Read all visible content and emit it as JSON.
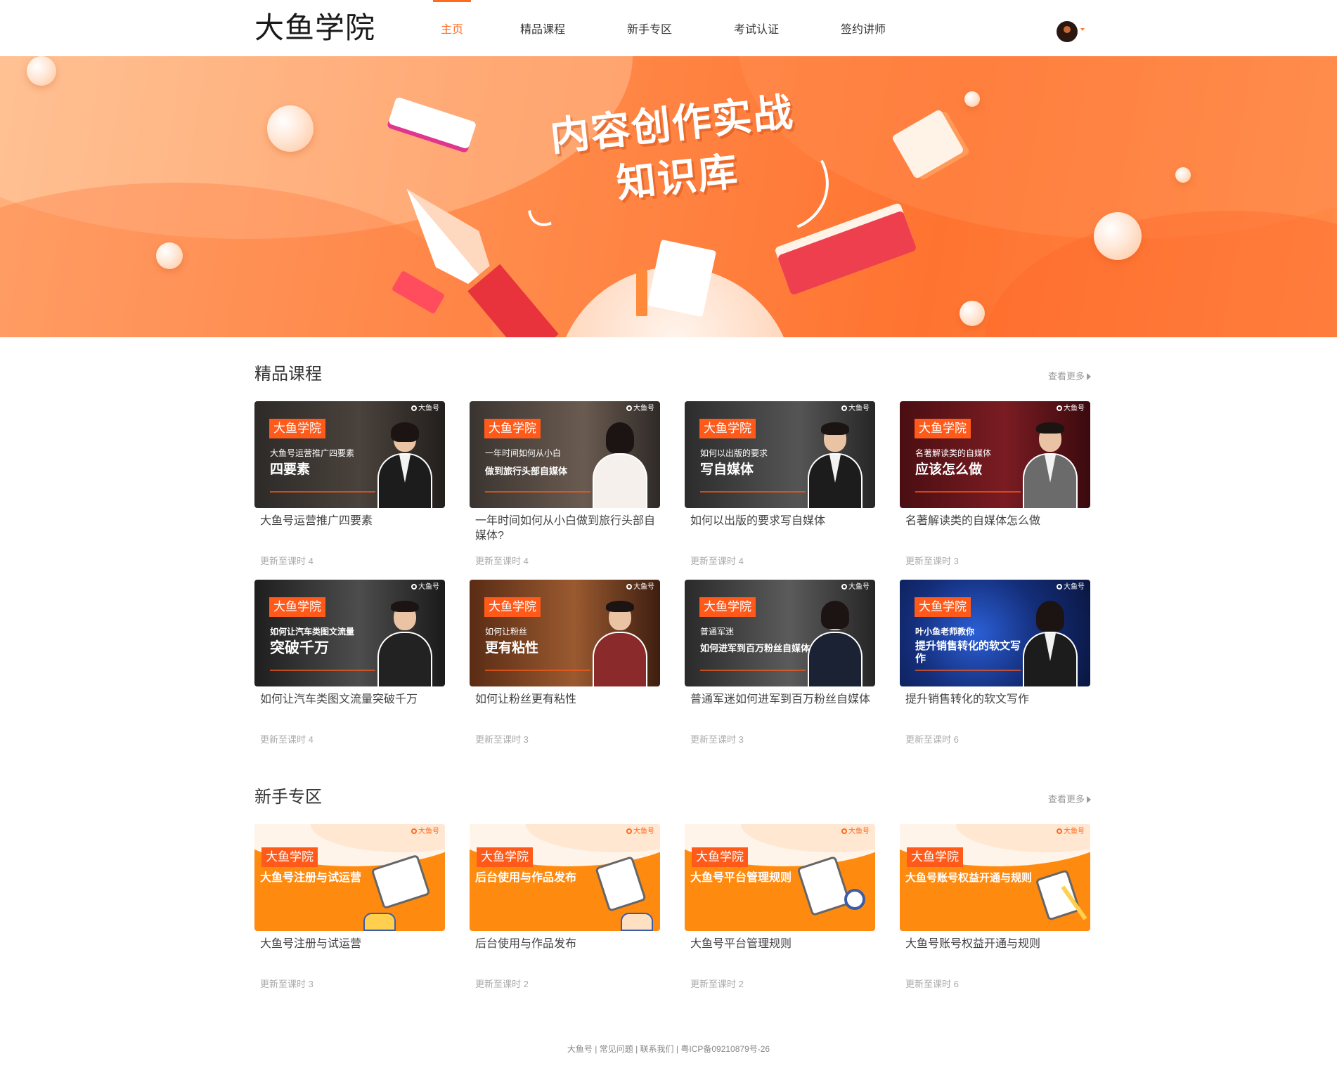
{
  "header": {
    "logo": "大鱼学院",
    "nav": [
      {
        "label": "主页",
        "active": true
      },
      {
        "label": "精品课程",
        "active": false
      },
      {
        "label": "新手专区",
        "active": false
      },
      {
        "label": "考试认证",
        "active": false
      },
      {
        "label": "签约讲师",
        "active": false
      }
    ]
  },
  "banner": {
    "title_line1": "内容创作实战",
    "title_line2": "知识库"
  },
  "premium": {
    "title": "精品课程",
    "more": "查看更多",
    "cards": [
      {
        "tag": "大鱼学院",
        "brand": "大鱼号",
        "sub": "大鱼号运营推广四要素",
        "main": "四要素",
        "title": "大鱼号运营推广四要素",
        "meta": "更新至课时 4"
      },
      {
        "tag": "大鱼学院",
        "brand": "大鱼号",
        "sub": "一年时间如何从小白",
        "main": "做到旅行头部自媒体",
        "title": "一年时间如何从小白做到旅行头部自媒体?",
        "meta": "更新至课时 4"
      },
      {
        "tag": "大鱼学院",
        "brand": "大鱼号",
        "sub": "如何以出版的要求",
        "main": "写自媒体",
        "title": "如何以出版的要求写自媒体",
        "meta": "更新至课时 4"
      },
      {
        "tag": "大鱼学院",
        "brand": "大鱼号",
        "sub": "名著解读类的自媒体",
        "main": "应该怎么做",
        "title": "名著解读类的自媒体怎么做",
        "meta": "更新至课时 3"
      },
      {
        "tag": "大鱼学院",
        "brand": "大鱼号",
        "sub": "如何让汽车类图文流量",
        "main": "突破千万",
        "title": "如何让汽车类图文流量突破千万",
        "meta": "更新至课时 4"
      },
      {
        "tag": "大鱼学院",
        "brand": "大鱼号",
        "sub": "如何让粉丝",
        "main": "更有粘性",
        "title": "如何让粉丝更有粘性",
        "meta": "更新至课时 3"
      },
      {
        "tag": "大鱼学院",
        "brand": "大鱼号",
        "sub": "普通军迷",
        "main": "如何进军到百万粉丝自媒体",
        "title": "普通军迷如何进军到百万粉丝自媒体",
        "meta": "更新至课时 3"
      },
      {
        "tag": "大鱼学院",
        "brand": "大鱼号",
        "sub": "叶小鱼老师教你",
        "main": "提升销售转化的软文写作",
        "title": "提升销售转化的软文写作",
        "meta": "更新至课时 6"
      }
    ]
  },
  "novice": {
    "title": "新手专区",
    "more": "查看更多",
    "cards": [
      {
        "tag": "大鱼学院",
        "brand": "大鱼号",
        "main": "大鱼号注册与试运营",
        "title": "大鱼号注册与试运营",
        "meta": "更新至课时 3"
      },
      {
        "tag": "大鱼学院",
        "brand": "大鱼号",
        "main": "后台使用与作品发布",
        "title": "后台使用与作品发布",
        "meta": "更新至课时 2"
      },
      {
        "tag": "大鱼学院",
        "brand": "大鱼号",
        "main": "大鱼号平台管理规则",
        "title": "大鱼号平台管理规则",
        "meta": "更新至课时 2"
      },
      {
        "tag": "大鱼学院",
        "brand": "大鱼号",
        "main": "大鱼号账号权益开通与规则",
        "title": "大鱼号账号权益开通与规则",
        "meta": "更新至课时 6"
      }
    ]
  },
  "footer": {
    "links": [
      "大鱼号",
      "常见问题",
      "联系我们"
    ],
    "icp": "粤ICP备09210879号-26"
  }
}
